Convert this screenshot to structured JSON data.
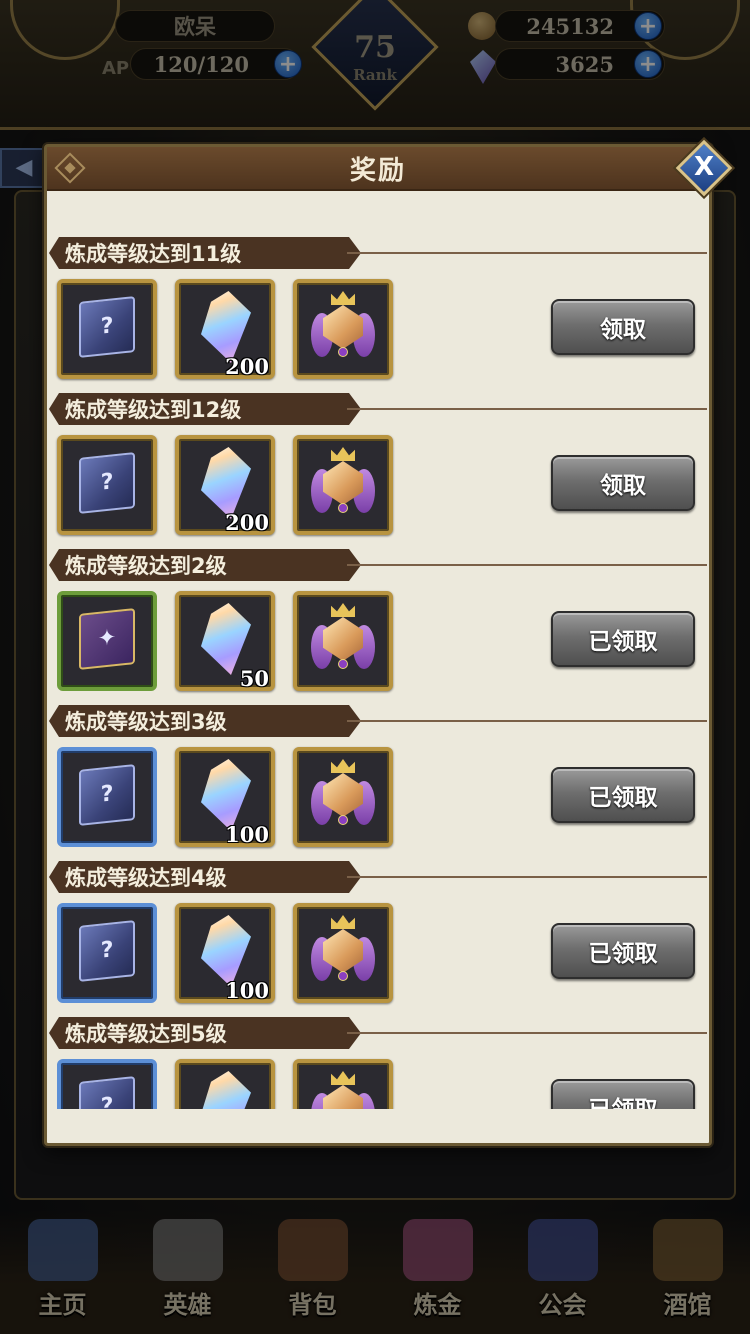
{
  "header": {
    "player_name": "欧呆",
    "ap_label": "AP",
    "ap_value": "120/120",
    "gold": "245132",
    "gems": "3625",
    "rank_value": "75",
    "rank_label": "Rank"
  },
  "modal": {
    "title": "奖励",
    "close_glyph": "X",
    "rows": [
      {
        "label": "炼成等级达到11级",
        "box_frame": "gold",
        "box_glyph": "?",
        "crystal_qty": "200",
        "button": "领取"
      },
      {
        "label": "炼成等级达到12级",
        "box_frame": "gold",
        "box_glyph": "?",
        "crystal_qty": "200",
        "button": "领取"
      },
      {
        "label": "炼成等级达到2级",
        "box_frame": "green",
        "box_glyph": "✦",
        "crystal_qty": "50",
        "button": "已领取"
      },
      {
        "label": "炼成等级达到3级",
        "box_frame": "blue",
        "box_glyph": "?",
        "crystal_qty": "100",
        "button": "已领取"
      },
      {
        "label": "炼成等级达到4级",
        "box_frame": "blue",
        "box_glyph": "?",
        "crystal_qty": "100",
        "button": "已领取"
      },
      {
        "label": "炼成等级达到5级",
        "box_frame": "blue",
        "box_glyph": "?",
        "crystal_qty": "",
        "button": "已领取"
      }
    ]
  },
  "nav": {
    "items": [
      {
        "label": "主页",
        "icon": "castle-icon",
        "color": "#4f6ea8"
      },
      {
        "label": "英雄",
        "icon": "helmet-icon",
        "color": "#8a8a8a"
      },
      {
        "label": "背包",
        "icon": "backpack-icon",
        "color": "#8a5a3a"
      },
      {
        "label": "炼金",
        "icon": "flask-icon",
        "color": "#b05a8a"
      },
      {
        "label": "公会",
        "icon": "guild-shield-icon",
        "color": "#4a5aa8"
      },
      {
        "label": "酒馆",
        "icon": "mug-icon",
        "color": "#8a6a3a"
      }
    ]
  }
}
